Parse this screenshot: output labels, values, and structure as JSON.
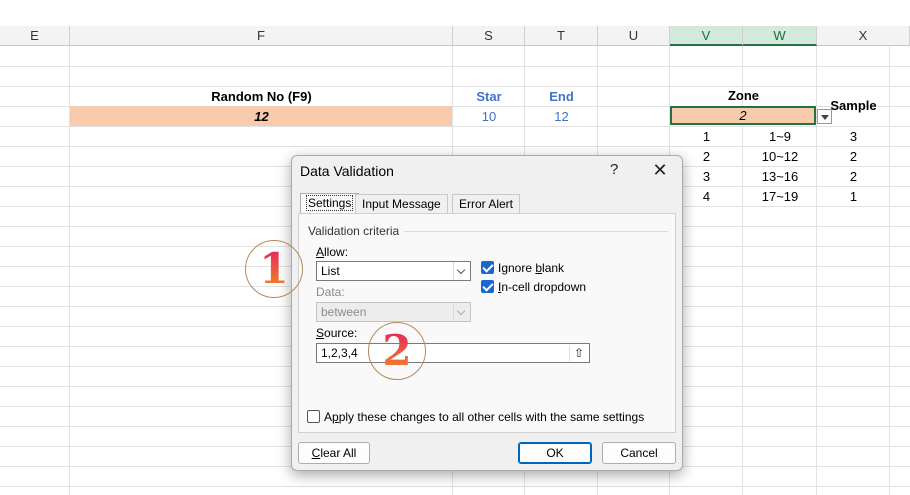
{
  "sheet": {
    "columns": [
      {
        "key": "E",
        "label": "E"
      },
      {
        "key": "F",
        "label": "F"
      },
      {
        "key": "S",
        "label": "S"
      },
      {
        "key": "T",
        "label": "T"
      },
      {
        "key": "U",
        "label": "U"
      },
      {
        "key": "V",
        "label": "V",
        "selected": true
      },
      {
        "key": "W",
        "label": "W",
        "selected": true
      },
      {
        "key": "X",
        "label": "X"
      }
    ],
    "random_header": "Random No (F9)",
    "random_value": "12",
    "star_header": "Star",
    "star_value": "10",
    "end_header": "End",
    "end_value": "12",
    "zone_header": "Zone",
    "zone_value": "2",
    "sample_header": "Sample",
    "zone_table": [
      {
        "zone": "1",
        "range": "1~9",
        "sample": "3"
      },
      {
        "zone": "2",
        "range": "10~12",
        "sample": "2"
      },
      {
        "zone": "3",
        "range": "13~16",
        "sample": "2"
      },
      {
        "zone": "4",
        "range": "17~19",
        "sample": "1"
      }
    ],
    "colors": {
      "accent": "#217346",
      "peach": "#f8cbad",
      "blue_text": "#4472c4"
    }
  },
  "dialog": {
    "title": "Data Validation",
    "help": "?",
    "close": "✕",
    "tabs": [
      "Settings",
      "Input Message",
      "Error Alert"
    ],
    "active_tab": "Settings",
    "group_label": "Validation criteria",
    "allow_label_pre": "",
    "allow_label_u": "A",
    "allow_label_post": "llow:",
    "allow_value": "List",
    "ignore_blank_pre": "Ignore ",
    "ignore_blank_u": "b",
    "ignore_blank_post": "lank",
    "ignore_blank_checked": true,
    "incell_u": "I",
    "incell_post": "n-cell dropdown",
    "incell_checked": true,
    "data_label": "Data:",
    "data_value": "between",
    "source_u": "S",
    "source_post": "ource:",
    "source_value": "1,2,3,4",
    "apply_pre": "A",
    "apply_u": "p",
    "apply_post": "ply these changes to all other cells with the same settings",
    "apply_checked": false,
    "clear_u": "C",
    "clear_post": "lear All",
    "ok_label": "OK",
    "cancel_label": "Cancel"
  },
  "annotations": [
    "1",
    "2"
  ]
}
